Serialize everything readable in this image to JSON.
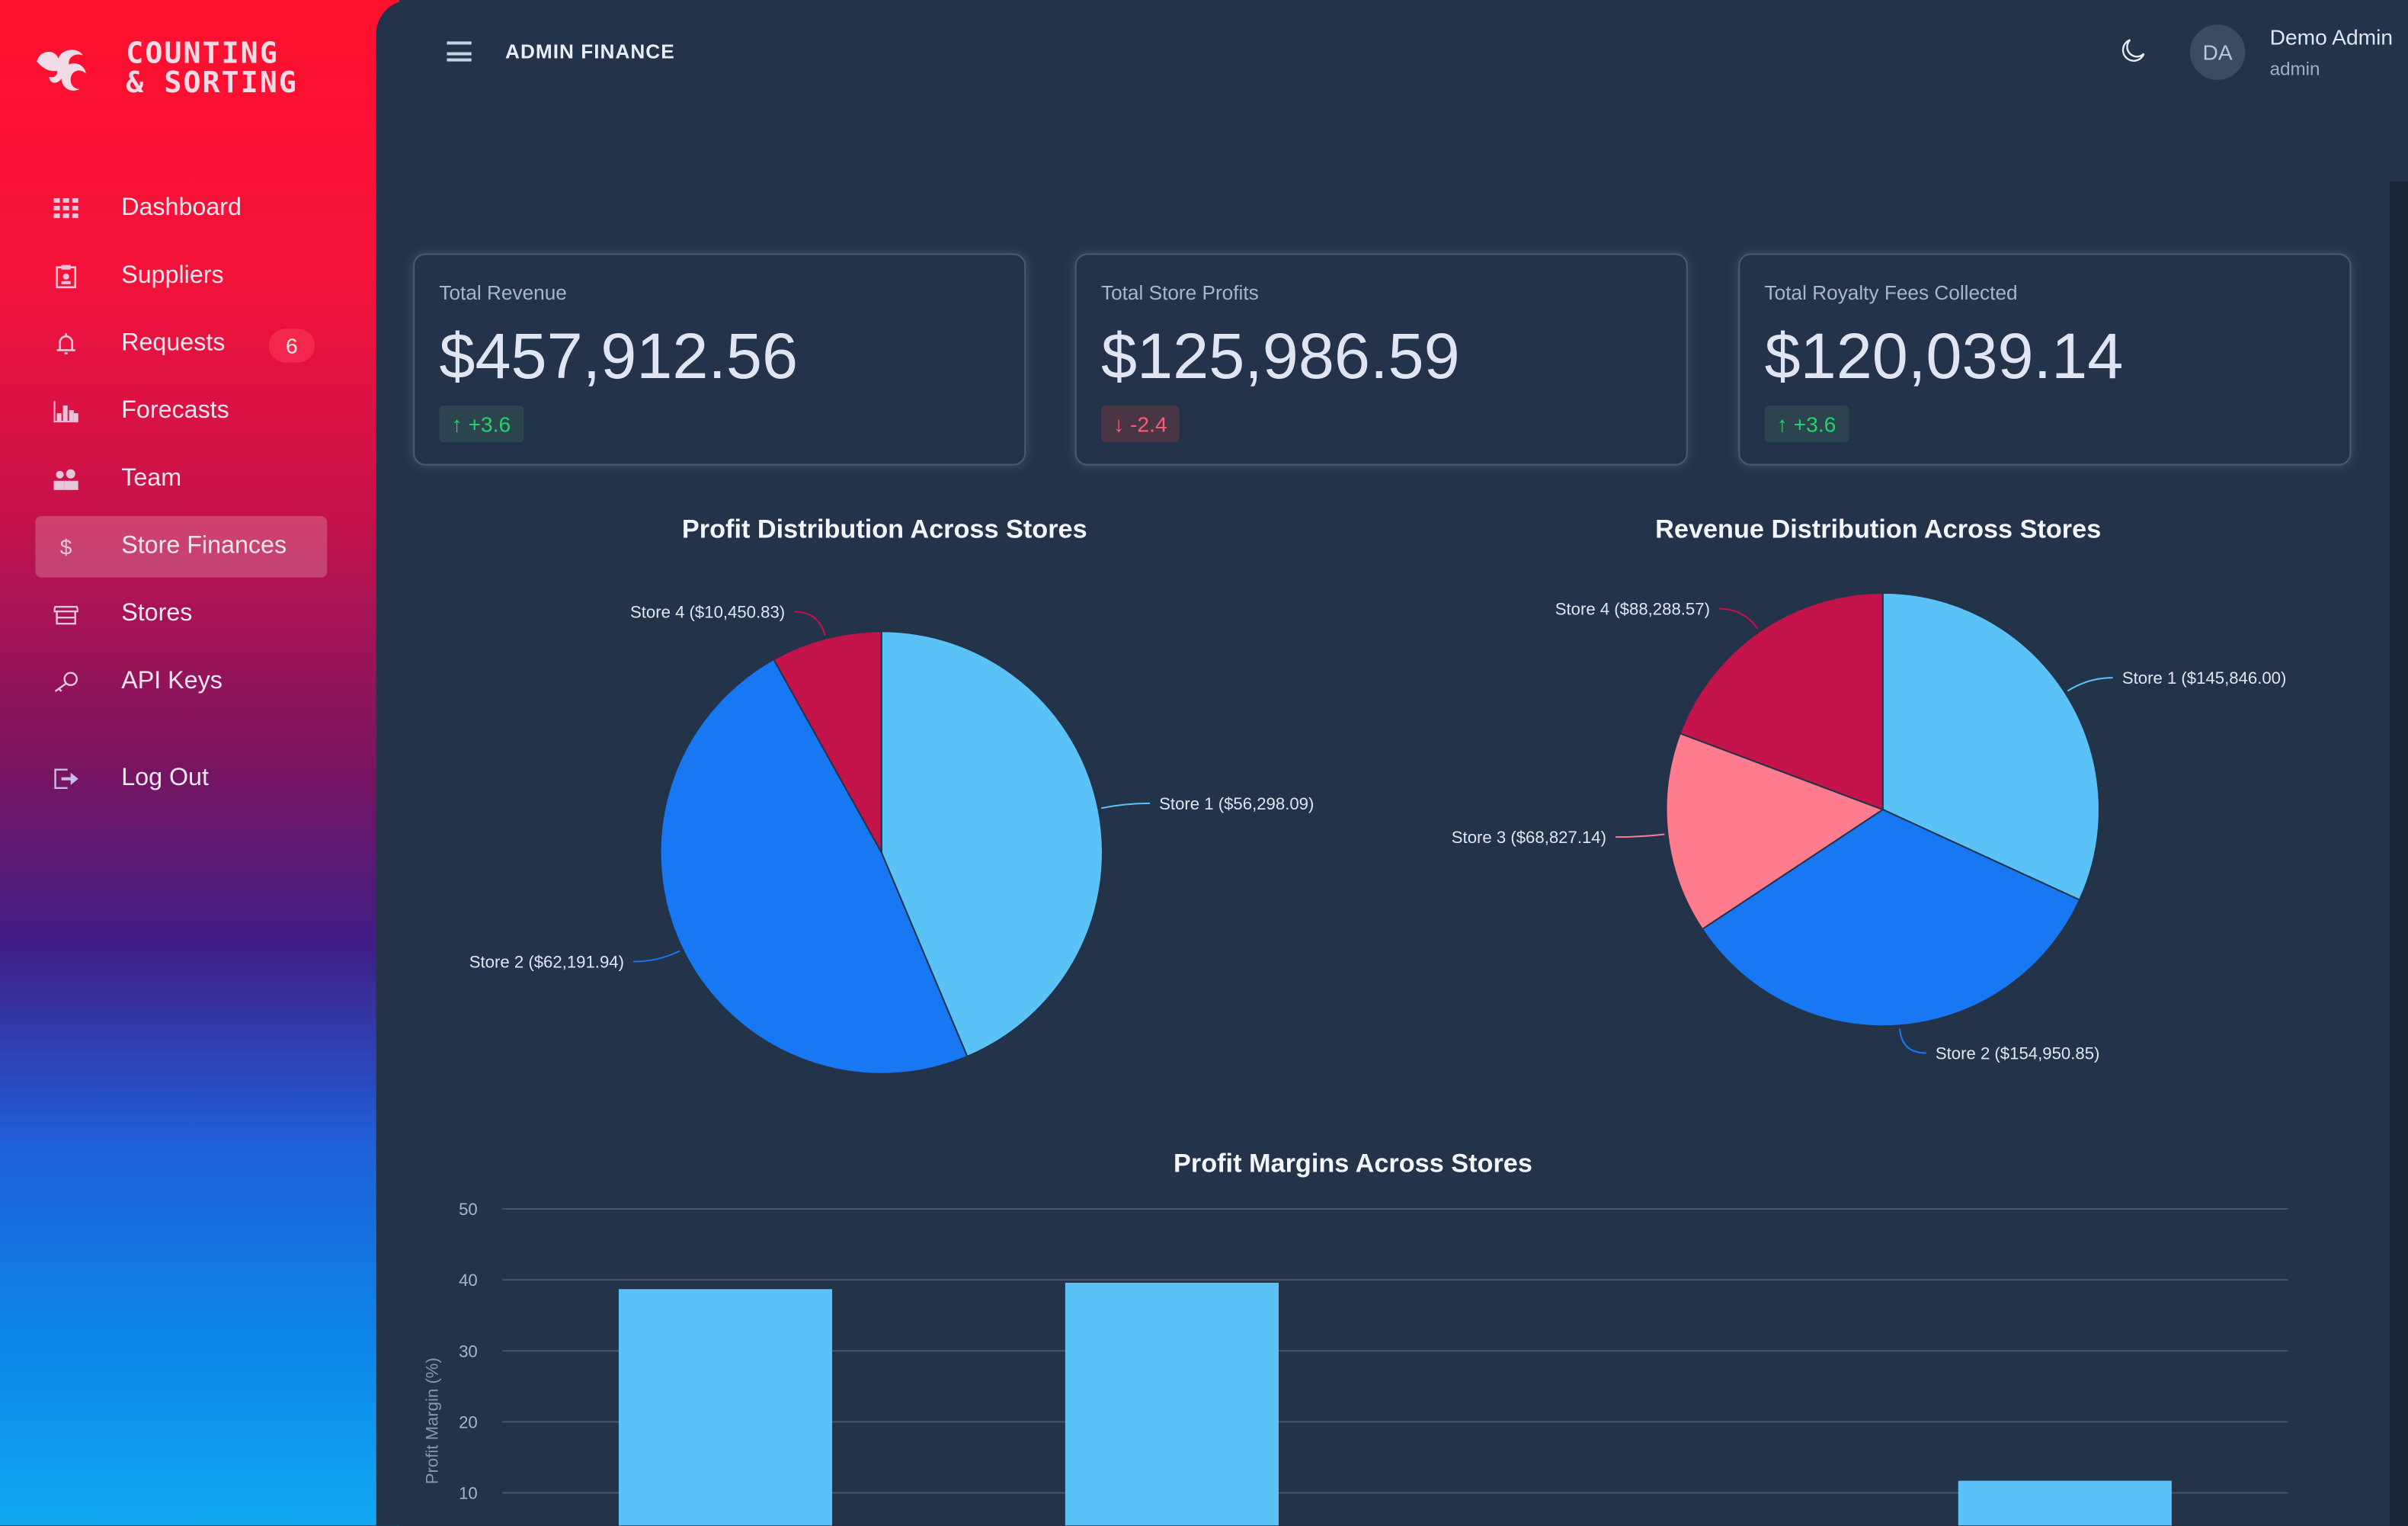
{
  "brand": {
    "line1": "COUNTING",
    "line2": "& SORTING"
  },
  "sidebar": {
    "items": [
      {
        "label": "Dashboard",
        "icon": "grid-icon"
      },
      {
        "label": "Suppliers",
        "icon": "id-badge-icon"
      },
      {
        "label": "Requests",
        "icon": "bell-icon",
        "badge": "6"
      },
      {
        "label": "Forecasts",
        "icon": "bar-chart-icon"
      },
      {
        "label": "Team",
        "icon": "users-icon"
      },
      {
        "label": "Store Finances",
        "icon": "dollar-icon",
        "active": true
      },
      {
        "label": "Stores",
        "icon": "store-icon"
      },
      {
        "label": "API Keys",
        "icon": "key-icon"
      }
    ],
    "logout": "Log Out"
  },
  "header": {
    "title": "ADMIN FINANCE",
    "user_initials": "DA",
    "user_name": "Demo Admin",
    "user_role": "admin"
  },
  "cards": [
    {
      "label": "Total Revenue",
      "value": "$457,912.56",
      "delta": "+3.6",
      "direction": "up"
    },
    {
      "label": "Total Store Profits",
      "value": "$125,986.59",
      "delta": "-2.4",
      "direction": "down"
    },
    {
      "label": "Total Royalty Fees Collected",
      "value": "$120,039.14",
      "delta": "+3.6",
      "direction": "up"
    }
  ],
  "colors": {
    "store1": "#5BC2F7",
    "store2": "#1877F2",
    "store3": "#FF7B8E",
    "store4": "#C4134A",
    "up": "#1FD46A",
    "down": "#FF5A7A"
  },
  "chart_data": [
    {
      "type": "pie",
      "title": "Profit Distribution Across Stores",
      "slices": [
        {
          "name": "Store 1",
          "value": 56298.09,
          "label": "Store 1 ($56,298.09)"
        },
        {
          "name": "Store 2",
          "value": 62191.94,
          "label": "Store 2 ($62,191.94)"
        },
        {
          "name": "Store 4",
          "value": 10450.83,
          "label": "Store 4 ($10,450.83)"
        }
      ]
    },
    {
      "type": "pie",
      "title": "Revenue Distribution Across Stores",
      "slices": [
        {
          "name": "Store 1",
          "value": 145846.0,
          "label": "Store 1 ($145,846.00)"
        },
        {
          "name": "Store 2",
          "value": 154950.85,
          "label": "Store 2 ($154,950.85)"
        },
        {
          "name": "Store 3",
          "value": 68827.14,
          "label": "Store 3 ($68,827.14)"
        },
        {
          "name": "Store 4",
          "value": 88288.57,
          "label": "Store 4 ($88,288.57)"
        }
      ]
    },
    {
      "type": "bar",
      "title": "Profit Margins Across Stores",
      "ylabel": "Profit Margin (%)",
      "yticks": [
        "10",
        "20",
        "30",
        "40",
        "50"
      ],
      "ylim": [
        0,
        50
      ],
      "grid": true,
      "values": [
        38.7,
        39.6,
        null,
        11.7
      ]
    }
  ]
}
